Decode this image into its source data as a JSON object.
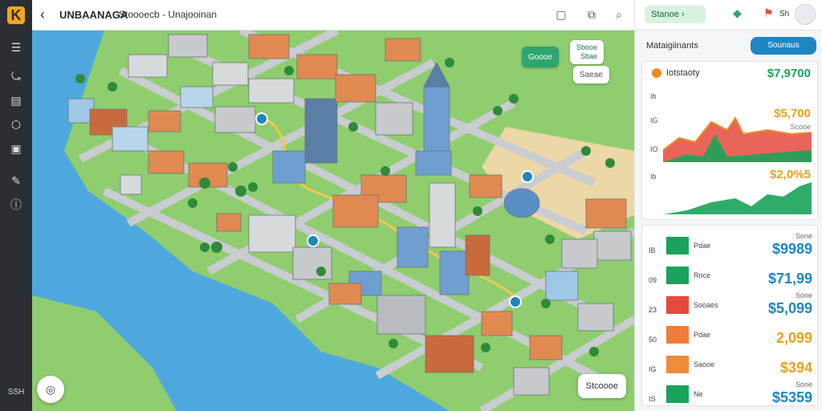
{
  "app": {
    "title": "UNBAANAGA",
    "breadcrumb": "Stoooecb - Unajooinan"
  },
  "rail": {
    "bottom_label": "SSH"
  },
  "right_top": {
    "search_label": "Stanoe"
  },
  "map": {
    "chip_left": "Goooe",
    "chip_right_line1": "Sbooe",
    "chip_right_line2": "Sbae",
    "chip_small": "Saeae",
    "bottom_right_button": "Stcoooe"
  },
  "panel": {
    "title": "Mataigiinants",
    "action_label": "Sounaus",
    "summary": {
      "title": "Iotstaoty",
      "value_top": "$7,9700",
      "value_mid": "$5,700",
      "value_mid_sub": "Scooe",
      "value_low": "$2,0%5",
      "y_labels": [
        "Ib",
        "IG",
        "IO",
        "Ib"
      ]
    },
    "list": [
      {
        "yl": "IB",
        "name": "Pdae",
        "small": "Sone",
        "big": "$9989",
        "color": "#1aa35a",
        "value_color": "#1f86c2"
      },
      {
        "yl": "09",
        "name": "Rnce",
        "small": "",
        "big": "$71,99",
        "color": "#1aa35a",
        "value_color": "#1f86c2"
      },
      {
        "yl": "23",
        "name": "Sooaes",
        "small": "Sone",
        "big": "$5,099",
        "color": "#e64a3c",
        "value_color": "#1f86c2"
      },
      {
        "yl": "50",
        "name": "Pdae",
        "small": "",
        "big": "2,099",
        "color": "#f07c3a",
        "value_color": "#e6a21c"
      },
      {
        "yl": "IG",
        "name": "Saooe",
        "small": "",
        "big": "$394",
        "color": "#f08a3c",
        "value_color": "#e6a21c"
      },
      {
        "yl": "IS",
        "name": "Ne",
        "small": "Sone",
        "big": "$5359",
        "color": "#1aa35a",
        "value_color": "#1f86c2"
      }
    ]
  },
  "colors": {
    "accent": "#1f86c2",
    "green": "#1aa35a",
    "orange": "#f08a24",
    "water": "#4fa8dd",
    "grass": "#7cc36a"
  }
}
